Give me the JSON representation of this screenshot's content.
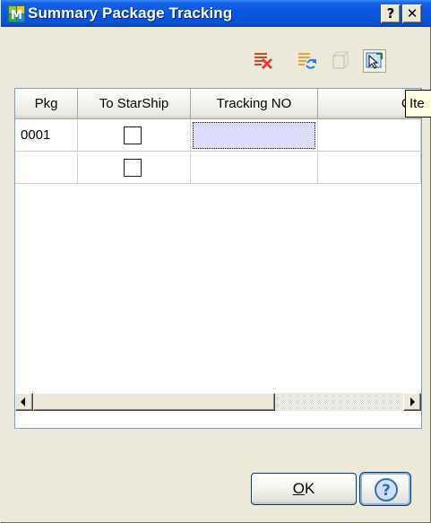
{
  "window": {
    "title": "Summary Package Tracking",
    "help_glyph": "?",
    "close_glyph": "✕"
  },
  "toolbar": {
    "icons": [
      "delete-rows-icon",
      "sync-icon",
      "blank-icon",
      "pointer-icon"
    ],
    "tooltip": "Ite"
  },
  "grid": {
    "columns": [
      "Pkg",
      "To StarShip",
      "Tracking NO",
      "Co"
    ],
    "rows": [
      {
        "pkg": "0001",
        "to_starship": false,
        "tracking": "",
        "extra": ""
      },
      {
        "pkg": "",
        "to_starship": false,
        "tracking": "",
        "extra": ""
      }
    ]
  },
  "buttons": {
    "ok_mnemonic": "O",
    "ok_rest": "K"
  },
  "colors": {
    "titlebar": "#0a53d9",
    "selected_cell": "#dcdcf8",
    "dialog_bg": "#ece9d8"
  }
}
